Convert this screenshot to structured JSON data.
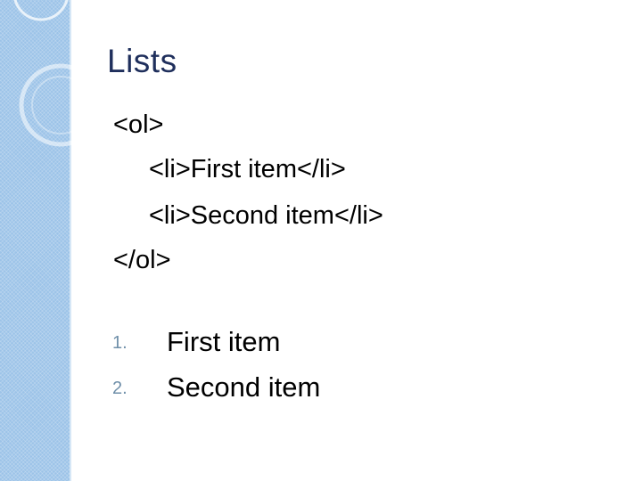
{
  "theme": {
    "band_color": "#9cc3e8",
    "title_color": "#1f2f5c",
    "number_color": "#6f8fa9"
  },
  "slide": {
    "title": "Lists",
    "code_lines": [
      "<ol>",
      "<li>First item</li>",
      "<li>Second item</li>",
      "</ol>"
    ],
    "rendered_list": [
      {
        "number": "1.",
        "text": "First item"
      },
      {
        "number": "2.",
        "text": "Second item"
      }
    ]
  }
}
